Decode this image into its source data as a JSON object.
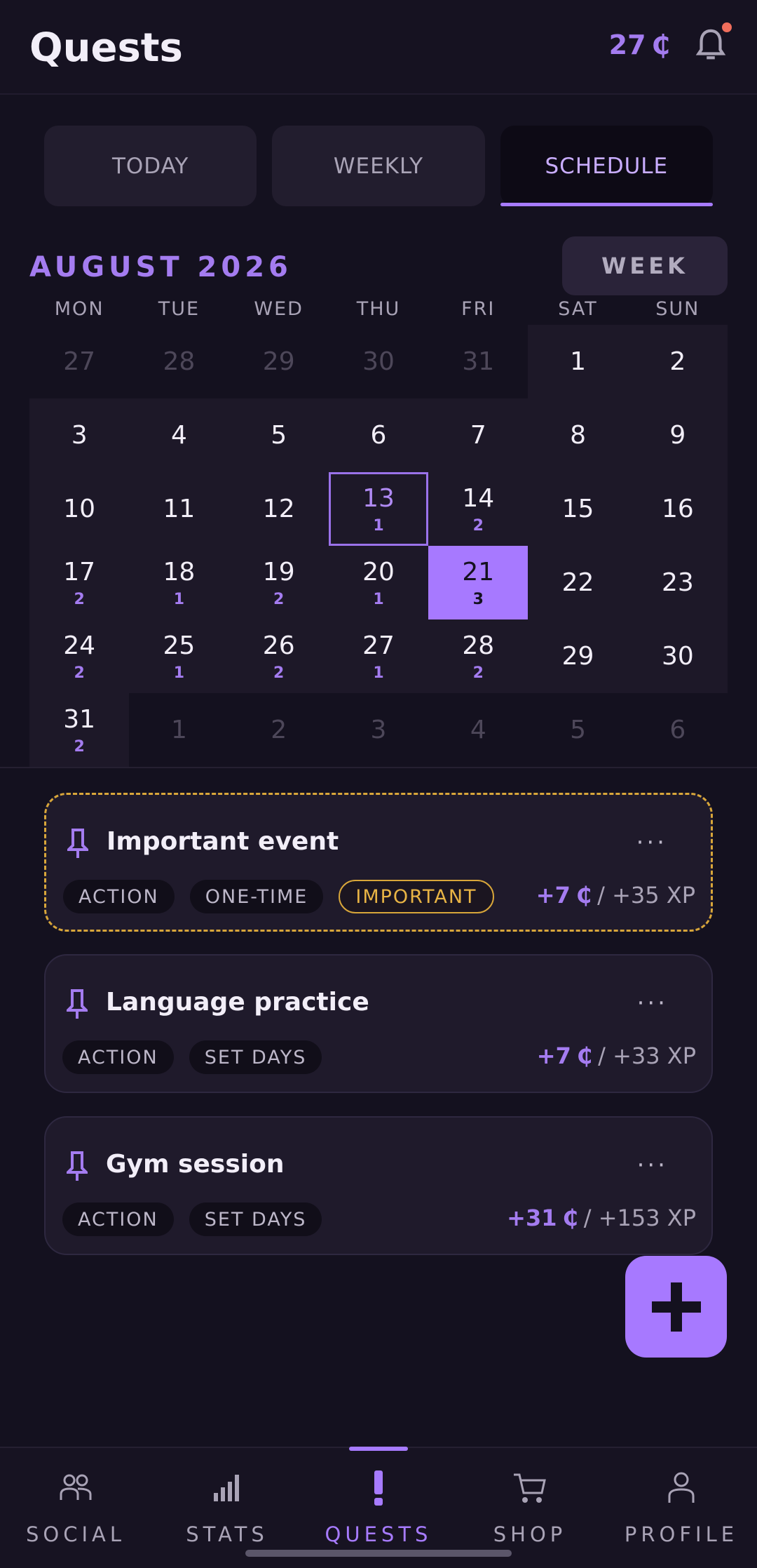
{
  "header": {
    "title": "Quests",
    "coins": "27",
    "coin_symbol": "₵"
  },
  "tabs": [
    {
      "label": "TODAY",
      "active": false
    },
    {
      "label": "WEEKLY",
      "active": false
    },
    {
      "label": "SCHEDULE",
      "active": true
    }
  ],
  "calendar": {
    "month_label": "AUGUST 2026",
    "view_button": "WEEK",
    "weekdays": [
      "MON",
      "TUE",
      "WED",
      "THU",
      "FRI",
      "SAT",
      "SUN"
    ],
    "days": [
      {
        "n": "27",
        "out": true
      },
      {
        "n": "28",
        "out": true
      },
      {
        "n": "29",
        "out": true
      },
      {
        "n": "30",
        "out": true
      },
      {
        "n": "31",
        "out": true
      },
      {
        "n": "1"
      },
      {
        "n": "2"
      },
      {
        "n": "3"
      },
      {
        "n": "4"
      },
      {
        "n": "5"
      },
      {
        "n": "6"
      },
      {
        "n": "7"
      },
      {
        "n": "8"
      },
      {
        "n": "9"
      },
      {
        "n": "10"
      },
      {
        "n": "11"
      },
      {
        "n": "12"
      },
      {
        "n": "13",
        "c": "1",
        "today": true
      },
      {
        "n": "14",
        "c": "2"
      },
      {
        "n": "15"
      },
      {
        "n": "16"
      },
      {
        "n": "17",
        "c": "2"
      },
      {
        "n": "18",
        "c": "1"
      },
      {
        "n": "19",
        "c": "2"
      },
      {
        "n": "20",
        "c": "1"
      },
      {
        "n": "21",
        "c": "3",
        "selected": true
      },
      {
        "n": "22"
      },
      {
        "n": "23"
      },
      {
        "n": "24",
        "c": "2"
      },
      {
        "n": "25",
        "c": "1"
      },
      {
        "n": "26",
        "c": "2"
      },
      {
        "n": "27",
        "c": "1"
      },
      {
        "n": "28",
        "c": "2"
      },
      {
        "n": "29"
      },
      {
        "n": "30"
      },
      {
        "n": "31",
        "c": "2"
      },
      {
        "n": "1",
        "out": true
      },
      {
        "n": "2",
        "out": true
      },
      {
        "n": "3",
        "out": true
      },
      {
        "n": "4",
        "out": true
      },
      {
        "n": "5",
        "out": true
      },
      {
        "n": "6",
        "out": true
      }
    ]
  },
  "quests": [
    {
      "title": "Important event",
      "tags": [
        "ACTION",
        "ONE-TIME"
      ],
      "important_tag": "IMPORTANT",
      "coins": "+7",
      "xp": "/ +35 XP",
      "menu": "···"
    },
    {
      "title": "Language practice",
      "tags": [
        "ACTION",
        "SET DAYS"
      ],
      "coins": "+7",
      "xp": "/ +33 XP",
      "menu": "···"
    },
    {
      "title": "Gym session",
      "tags": [
        "ACTION",
        "SET DAYS"
      ],
      "coins": "+31",
      "xp": "/ +153 XP",
      "menu": "···"
    }
  ],
  "nav": [
    {
      "label": "SOCIAL",
      "icon": "social-icon"
    },
    {
      "label": "STATS",
      "icon": "stats-icon"
    },
    {
      "label": "QUESTS",
      "icon": "quests-icon",
      "active": true
    },
    {
      "label": "SHOP",
      "icon": "cart-icon"
    },
    {
      "label": "PROFILE",
      "icon": "profile-icon"
    }
  ],
  "colors": {
    "accent": "#a779ff",
    "important": "#d8a63a",
    "background": "#14111f"
  }
}
